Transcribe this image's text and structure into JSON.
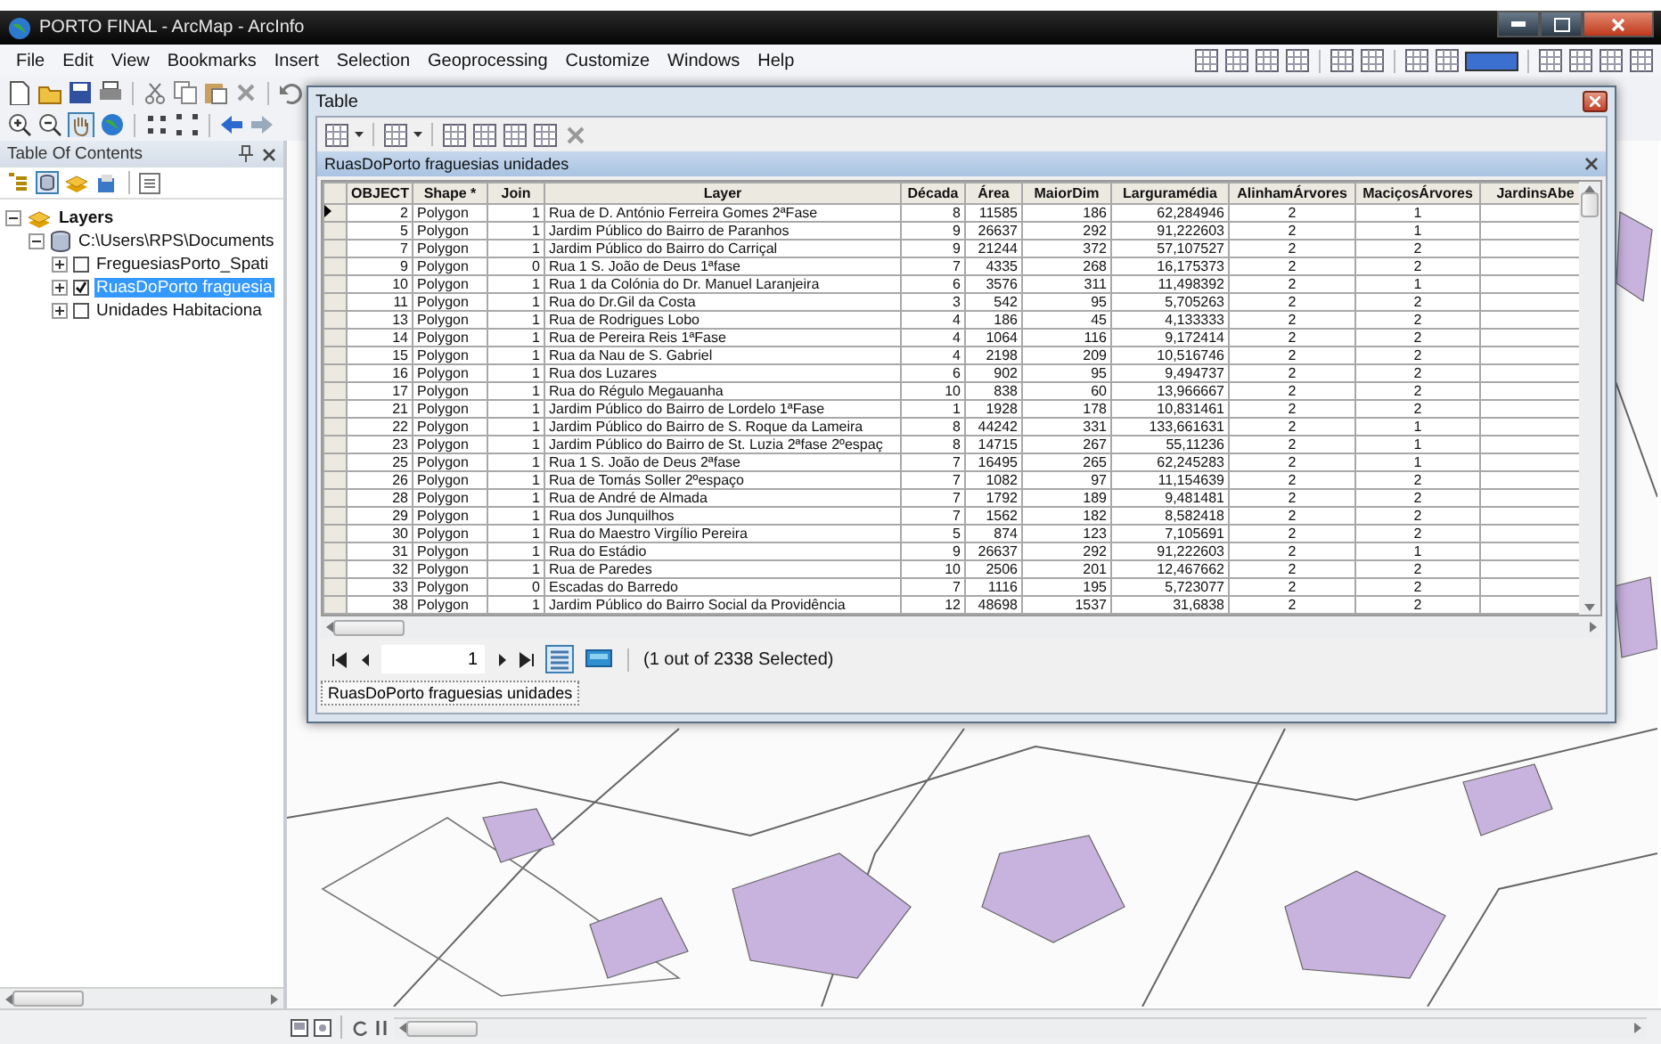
{
  "window": {
    "title": "PORTO FINAL - ArcMap - ArcInfo"
  },
  "menu": [
    "File",
    "Edit",
    "View",
    "Bookmarks",
    "Insert",
    "Selection",
    "Geoprocessing",
    "Customize",
    "Windows",
    "Help"
  ],
  "toc": {
    "title": "Table Of Contents",
    "tree": [
      {
        "label": "Layers",
        "kind": "frame",
        "expanded": true,
        "selected": false,
        "children": [
          {
            "label": "C:\\Users\\RPS\\Documents",
            "kind": "workspace",
            "expanded": true,
            "selected": false,
            "children": [
              {
                "label": "FreguesiasPorto_Spati",
                "kind": "layer",
                "expanded": false,
                "checked": false,
                "selected": false
              },
              {
                "label": "RuasDoPorto fraguesia",
                "kind": "layer",
                "expanded": false,
                "checked": true,
                "selected": true
              },
              {
                "label": "Unidades Habitaciona",
                "kind": "layer",
                "expanded": false,
                "checked": false,
                "selected": false
              }
            ]
          }
        ]
      }
    ]
  },
  "table_window": {
    "title": "Table",
    "table_name": "RuasDoPorto fraguesias unidades",
    "columns": [
      {
        "label": "OBJECT",
        "kind": "number"
      },
      {
        "label": "Shape *",
        "kind": "text"
      },
      {
        "label": "Join",
        "kind": "number"
      },
      {
        "label": "Layer",
        "kind": "text"
      },
      {
        "label": "Década",
        "kind": "number"
      },
      {
        "label": "Área",
        "kind": "number"
      },
      {
        "label": "MaiorDim",
        "kind": "number"
      },
      {
        "label": "Larguramédia",
        "kind": "number"
      },
      {
        "label": "AlinhamÁrvores",
        "kind": "center"
      },
      {
        "label": "MaciçosÁrvores",
        "kind": "center"
      },
      {
        "label": "JardinsAbe",
        "kind": "text"
      }
    ],
    "rows": [
      {
        "current": true,
        "cells": [
          "2",
          "Polygon",
          "1",
          "Rua de D. António Ferreira Gomes 2ªFase",
          "8",
          "11585",
          "186",
          "62,284946",
          "2",
          "1"
        ]
      },
      {
        "current": false,
        "cells": [
          "5",
          "Polygon",
          "1",
          "Jardim Público do Bairro de Paranhos",
          "9",
          "26637",
          "292",
          "91,222603",
          "2",
          "1"
        ]
      },
      {
        "current": false,
        "cells": [
          "7",
          "Polygon",
          "1",
          "Jardim Público do Bairro do Carriçal",
          "9",
          "21244",
          "372",
          "57,107527",
          "2",
          "2"
        ]
      },
      {
        "current": false,
        "cells": [
          "9",
          "Polygon",
          "0",
          "Rua 1 S. João de Deus 1ªfase",
          "7",
          "4335",
          "268",
          "16,175373",
          "2",
          "2"
        ]
      },
      {
        "current": false,
        "cells": [
          "10",
          "Polygon",
          "1",
          "Rua 1 da Colónia do Dr. Manuel Laranjeira",
          "6",
          "3576",
          "311",
          "11,498392",
          "2",
          "1"
        ]
      },
      {
        "current": false,
        "cells": [
          "11",
          "Polygon",
          "1",
          "Rua do Dr.Gil da Costa",
          "3",
          "542",
          "95",
          "5,705263",
          "2",
          "2"
        ]
      },
      {
        "current": false,
        "cells": [
          "13",
          "Polygon",
          "1",
          "Rua de Rodrigues Lobo",
          "4",
          "186",
          "45",
          "4,133333",
          "2",
          "2"
        ]
      },
      {
        "current": false,
        "cells": [
          "14",
          "Polygon",
          "1",
          "Rua de Pereira Reis 1ªFase",
          "4",
          "1064",
          "116",
          "9,172414",
          "2",
          "2"
        ]
      },
      {
        "current": false,
        "cells": [
          "15",
          "Polygon",
          "1",
          "Rua da Nau de S. Gabriel",
          "4",
          "2198",
          "209",
          "10,516746",
          "2",
          "2"
        ]
      },
      {
        "current": false,
        "cells": [
          "16",
          "Polygon",
          "1",
          "Rua dos Luzares",
          "6",
          "902",
          "95",
          "9,494737",
          "2",
          "2"
        ]
      },
      {
        "current": false,
        "cells": [
          "17",
          "Polygon",
          "1",
          "Rua do Régulo Megauanha",
          "10",
          "838",
          "60",
          "13,966667",
          "2",
          "2"
        ]
      },
      {
        "current": false,
        "cells": [
          "21",
          "Polygon",
          "1",
          "Jardim Público do Bairro de Lordelo 1ªFase",
          "1",
          "1928",
          "178",
          "10,831461",
          "2",
          "2"
        ]
      },
      {
        "current": false,
        "cells": [
          "22",
          "Polygon",
          "1",
          "Jardim Público do Bairro de S. Roque da Lameira",
          "8",
          "44242",
          "331",
          "133,661631",
          "2",
          "1"
        ]
      },
      {
        "current": false,
        "cells": [
          "23",
          "Polygon",
          "1",
          "Jardim Público do Bairro de St. Luzia 2ªfase 2ºespaç",
          "8",
          "14715",
          "267",
          "55,11236",
          "2",
          "1"
        ]
      },
      {
        "current": false,
        "cells": [
          "25",
          "Polygon",
          "1",
          "Rua 1 S. João de Deus 2ªfase",
          "7",
          "16495",
          "265",
          "62,245283",
          "2",
          "1"
        ]
      },
      {
        "current": false,
        "cells": [
          "26",
          "Polygon",
          "1",
          "Rua de Tomás Soller 2ºespaço",
          "7",
          "1082",
          "97",
          "11,154639",
          "2",
          "2"
        ]
      },
      {
        "current": false,
        "cells": [
          "28",
          "Polygon",
          "1",
          "Rua de André de Almada",
          "7",
          "1792",
          "189",
          "9,481481",
          "2",
          "2"
        ]
      },
      {
        "current": false,
        "cells": [
          "29",
          "Polygon",
          "1",
          "Rua dos Junquilhos",
          "7",
          "1562",
          "182",
          "8,582418",
          "2",
          "2"
        ]
      },
      {
        "current": false,
        "cells": [
          "30",
          "Polygon",
          "1",
          "Rua do Maestro Virgílio Pereira",
          "5",
          "874",
          "123",
          "7,105691",
          "2",
          "2"
        ]
      },
      {
        "current": false,
        "cells": [
          "31",
          "Polygon",
          "1",
          "Rua do Estádio",
          "9",
          "26637",
          "292",
          "91,222603",
          "2",
          "1"
        ]
      },
      {
        "current": false,
        "cells": [
          "32",
          "Polygon",
          "1",
          "Rua de Paredes",
          "10",
          "2506",
          "201",
          "12,467662",
          "2",
          "2"
        ]
      },
      {
        "current": false,
        "cells": [
          "33",
          "Polygon",
          "0",
          "Escadas do Barredo",
          "7",
          "1116",
          "195",
          "5,723077",
          "2",
          "2"
        ]
      },
      {
        "current": false,
        "cells": [
          "38",
          "Polygon",
          "1",
          "Jardim Público do Bairro Social da Providência",
          "12",
          "48698",
          "1537",
          "31,6838",
          "2",
          "2"
        ]
      }
    ],
    "record": "1",
    "status": "(1 out of 2338 Selected)",
    "tabs": [
      {
        "label": "RuasDoPorto fraguesias unidades",
        "selected": true
      }
    ]
  }
}
